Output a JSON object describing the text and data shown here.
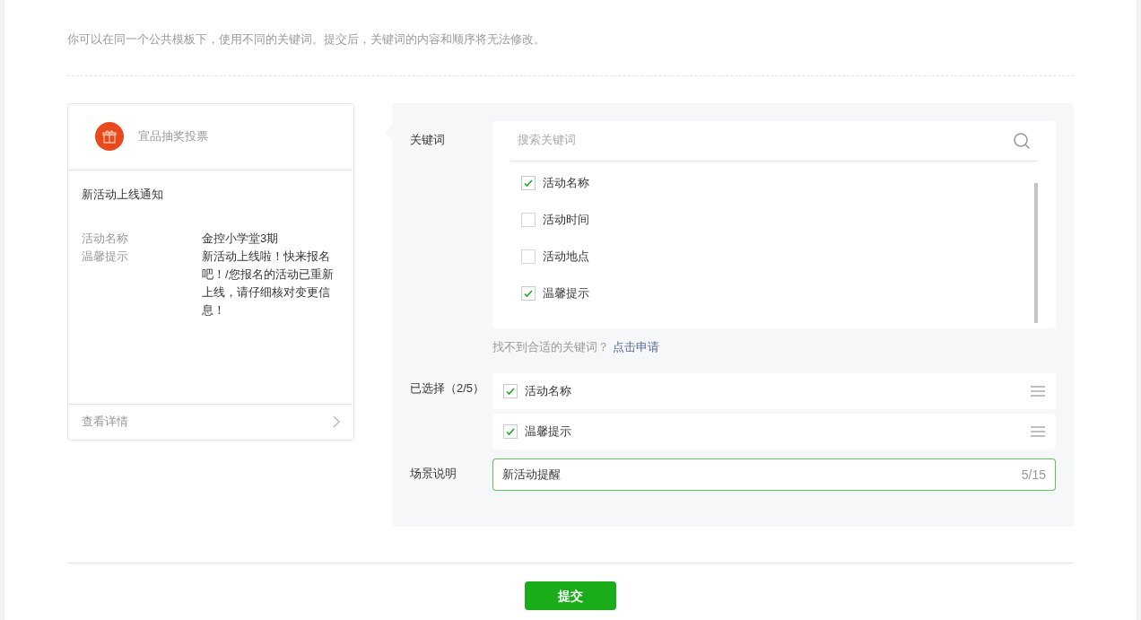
{
  "intro": "你可以在同一个公共模板下，使用不同的关键词。提交后，关键词的内容和顺序将无法修改。",
  "preview": {
    "account": "宜品抽奖投票",
    "title": "新活动上线通知",
    "fields": [
      {
        "label": "活动名称",
        "value": "金控小学堂3期"
      },
      {
        "label": "温馨提示",
        "value": "新活动上线啦！快来报名吧！/您报名的活动已重新上线，请仔细核对变更信息！"
      }
    ],
    "footer": "查看详情"
  },
  "keywords": {
    "label": "关键词",
    "search": {
      "placeholder": "搜索关键词"
    },
    "items": [
      {
        "text": "活动名称",
        "checked": true
      },
      {
        "text": "活动时间",
        "checked": false
      },
      {
        "text": "活动地点",
        "checked": false
      },
      {
        "text": "温馨提示",
        "checked": true
      }
    ],
    "hint": "找不到合适的关键词？",
    "apply_link": "点击申请"
  },
  "selected": {
    "label": "已选择（2/5）",
    "items": [
      {
        "text": "活动名称",
        "checked": true
      },
      {
        "text": "温馨提示",
        "checked": true
      }
    ]
  },
  "scene": {
    "label": "场景说明",
    "value": "新活动提醒",
    "count": "5/15"
  },
  "submit": "提交"
}
